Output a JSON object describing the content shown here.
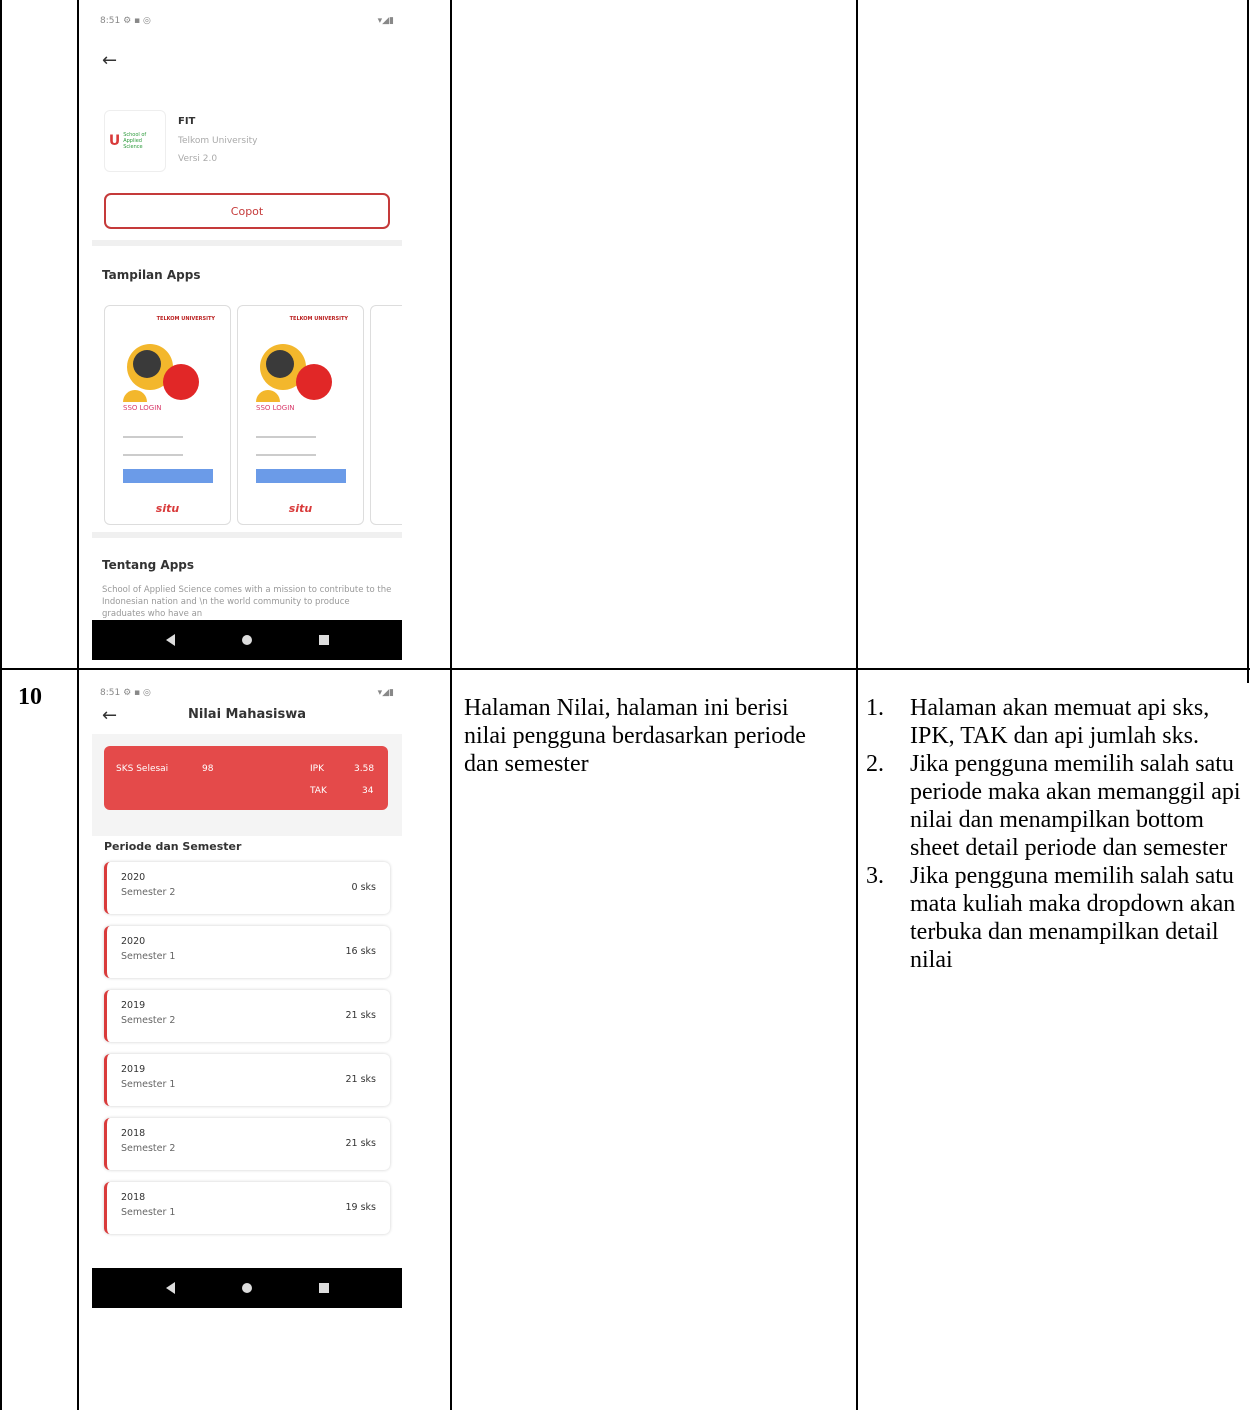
{
  "row_number": "10",
  "description": "Halaman Nilai, halaman ini berisi nilai pengguna berdasarkan periode dan semester",
  "steps": [
    {
      "num": "1.",
      "text": "Halaman akan memuat api sks, IPK, TAK dan api jumlah sks."
    },
    {
      "num": "2.",
      "text": "Jika pengguna memilih salah satu periode maka akan memanggil api nilai dan menampilkan bottom sheet detail periode dan semester"
    },
    {
      "num": "3.",
      "text": "Jika pengguna memilih salah satu mata kuliah maka dropdown akan terbuka dan menampilkan detail nilai"
    }
  ],
  "phone1": {
    "status_left": "8:51 ⚙ ▪ ◎",
    "status_right": "▾◢▮",
    "app_name": "FIT",
    "developer": "Telkom University",
    "version": "Versi 2.0",
    "logo_text": "School of Applied Science",
    "uninstall_label": "Copot",
    "screenshots_title": "Tampilan Apps",
    "shot_header": "TELKOM UNIVERSITY",
    "shot_sso": "SSO LOGIN",
    "shot_brand": "situ",
    "about_title": "Tentang Apps",
    "about_text": "School of Applied Science comes with a mission to contribute to the Indonesian nation and \\n the world community to produce graduates who have an"
  },
  "phone2": {
    "status_left": "8:51 ⚙ ▪ ◎",
    "status_right": "▾◢▮",
    "title": "Nilai Mahasiswa",
    "summary": {
      "sks_label": "SKS Selesai",
      "sks_value": "98",
      "ipk_label": "IPK",
      "ipk_value": "3.58",
      "tak_label": "TAK",
      "tak_value": "34"
    },
    "section_title": "Periode dan Semester",
    "periods": [
      {
        "year": "2020",
        "semester": "Semester 2",
        "sks": "0 sks"
      },
      {
        "year": "2020",
        "semester": "Semester 1",
        "sks": "16 sks"
      },
      {
        "year": "2019",
        "semester": "Semester 2",
        "sks": "21 sks"
      },
      {
        "year": "2019",
        "semester": "Semester 1",
        "sks": "21 sks"
      },
      {
        "year": "2018",
        "semester": "Semester 2",
        "sks": "21 sks"
      },
      {
        "year": "2018",
        "semester": "Semester 1",
        "sks": "19 sks"
      }
    ]
  }
}
